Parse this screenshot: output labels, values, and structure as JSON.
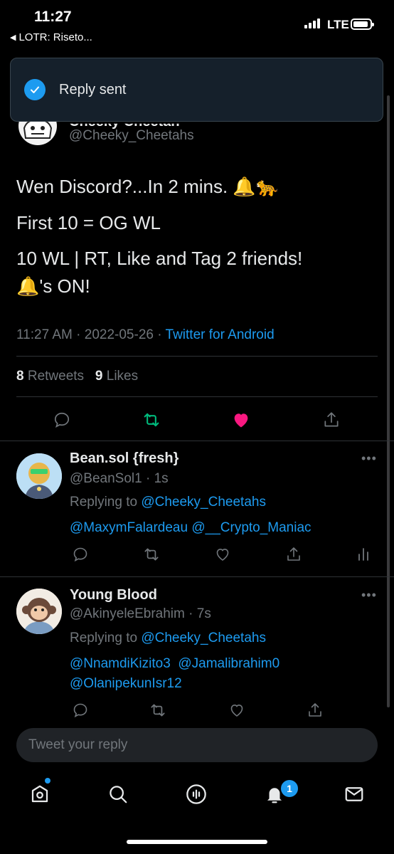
{
  "status_bar": {
    "time": "11:27",
    "back_app": "LOTR: Riseto...",
    "network": "LTE"
  },
  "toast": {
    "text": "Reply sent",
    "icon": "check-icon"
  },
  "main_tweet": {
    "name": "Cheeky Cheetah",
    "handle": "@Cheeky_Cheetahs",
    "lines": [
      "Wen Discord?...In 2 mins. 🔔🐆",
      "First 10 = OG WL",
      "10 WL | RT, Like and Tag 2 friends!",
      "🔔's ON!"
    ],
    "time": "11:27 AM",
    "date": "2022-05-26",
    "source": "Twitter for Android",
    "retweets": "8",
    "retweets_label": "Retweets",
    "likes": "9",
    "likes_label": "Likes"
  },
  "replies": [
    {
      "name": "Bean.sol {fresh}",
      "handle": "@BeanSol1",
      "time": "1s",
      "replying_label": "Replying to",
      "replying_to": "@Cheeky_Cheetahs",
      "mentions": "@MaxymFalardeau @__Crypto_Maniac"
    },
    {
      "name": "Young Blood",
      "handle": "@AkinyeleEbrahim",
      "time": "7s",
      "replying_label": "Replying to",
      "replying_to": "@Cheeky_Cheetahs",
      "mentions_line1": "@NnamdiKizito3  @Jamalibrahim0",
      "mentions_line2": "@OlanipekunIsr12"
    }
  ],
  "reply_input": {
    "placeholder": "Tweet your reply"
  },
  "nav": {
    "notifications_count": "1"
  },
  "colors": {
    "accent": "#1d9bf0",
    "retweet": "#00ba7c",
    "like": "#f91880"
  }
}
